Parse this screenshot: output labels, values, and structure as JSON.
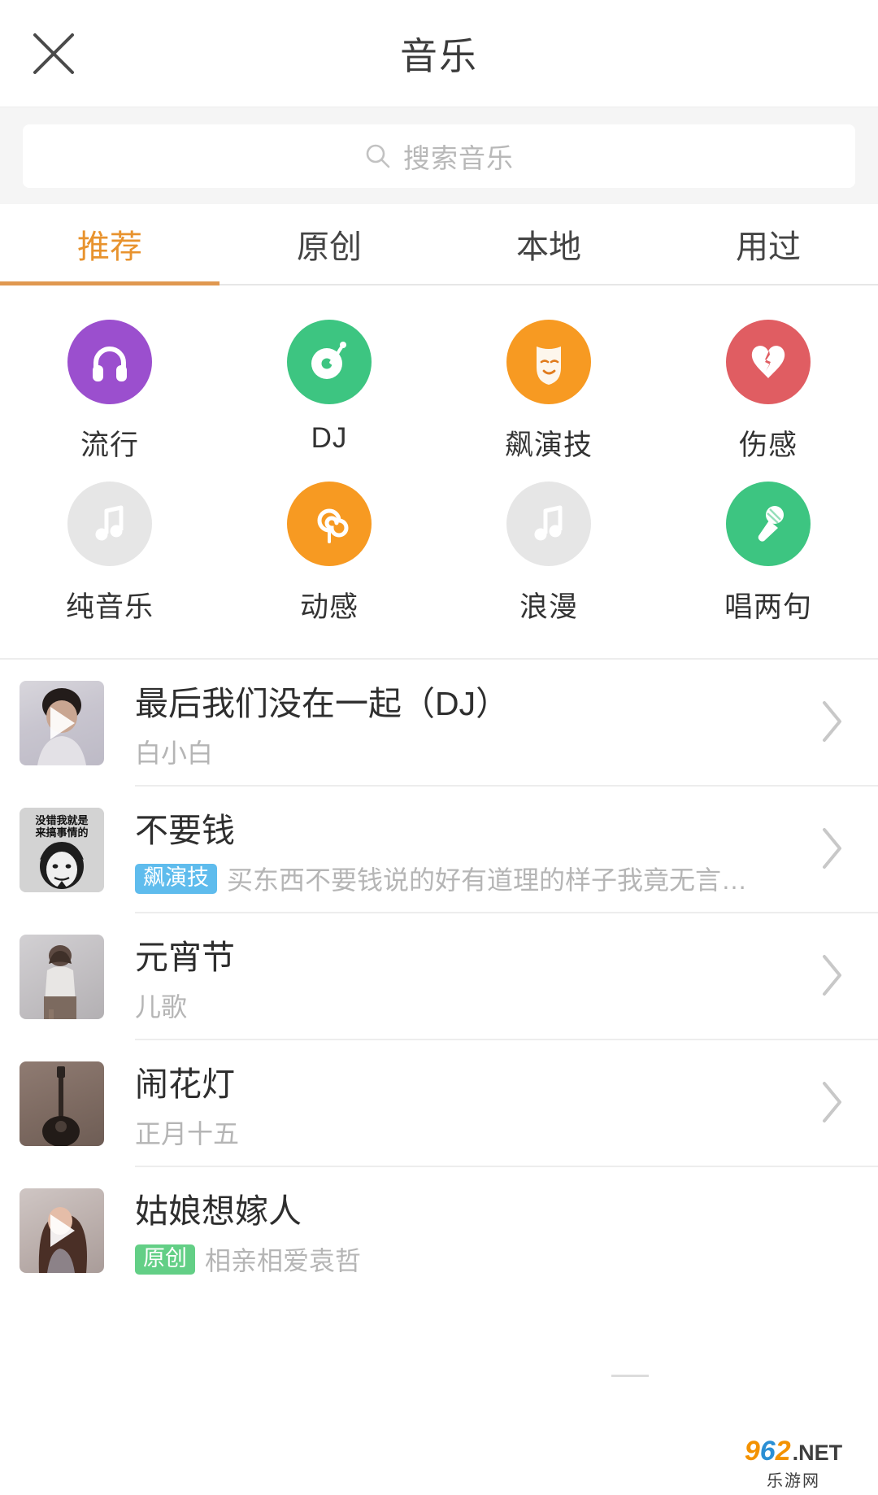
{
  "header": {
    "title": "音乐",
    "close_icon": "close-icon"
  },
  "search": {
    "placeholder": "搜索音乐",
    "icon": "search-icon"
  },
  "tabs": [
    {
      "label": "推荐",
      "active": true
    },
    {
      "label": "原创",
      "active": false
    },
    {
      "label": "本地",
      "active": false
    },
    {
      "label": "用过",
      "active": false
    }
  ],
  "categories": [
    {
      "label": "流行",
      "icon": "headphones-icon",
      "color": "#9b4fce",
      "muted": false
    },
    {
      "label": "DJ",
      "icon": "turntable-icon",
      "color": "#3dc581",
      "muted": false
    },
    {
      "label": "飙演技",
      "icon": "theater-mask-icon",
      "color": "#f79a22",
      "muted": false
    },
    {
      "label": "伤感",
      "icon": "broken-heart-icon",
      "color": "#e05d62",
      "muted": false
    },
    {
      "label": "纯音乐",
      "icon": "music-note-icon",
      "color": "#e6e6e6",
      "muted": true
    },
    {
      "label": "动感",
      "icon": "spiral-icon",
      "color": "#f79a22",
      "muted": false
    },
    {
      "label": "浪漫",
      "icon": "music-note-icon",
      "color": "#e6e6e6",
      "muted": true
    },
    {
      "label": "唱两句",
      "icon": "microphone-icon",
      "color": "#3dc581",
      "muted": false
    }
  ],
  "songs": [
    {
      "title": "最后我们没在一起（DJ）",
      "subtitle": "白小白",
      "tag": "",
      "tag_color": "",
      "thumb_kind": "portrait-man",
      "has_play": true,
      "chevron": "chevron-right-icon"
    },
    {
      "title": "不要钱",
      "subtitle": "买东西不要钱说的好有道理的样子我竟无言…",
      "tag": "飙演技",
      "tag_color": "#5fbced",
      "thumb_kind": "meme-face",
      "thumb_text": "没错我就是来搞事情的",
      "has_play": false,
      "chevron": "chevron-right-icon"
    },
    {
      "title": "元宵节",
      "subtitle": "儿歌",
      "tag": "",
      "tag_color": "",
      "thumb_kind": "portrait-girl",
      "has_play": false,
      "chevron": "chevron-right-icon"
    },
    {
      "title": "闹花灯",
      "subtitle": "正月十五",
      "tag": "",
      "tag_color": "",
      "thumb_kind": "guitar",
      "has_play": false,
      "chevron": "chevron-right-icon"
    },
    {
      "title": "姑娘想嫁人",
      "subtitle": "相亲相爱袁哲",
      "tag": "原创",
      "tag_color": "#63cf86",
      "thumb_kind": "portrait-woman",
      "has_play": true,
      "chevron": "chevron-right-icon"
    }
  ],
  "watermark": {
    "num9": "9",
    "num6": "6",
    "num2": "2",
    "dotnet": ".NET",
    "cn": "乐游网"
  }
}
